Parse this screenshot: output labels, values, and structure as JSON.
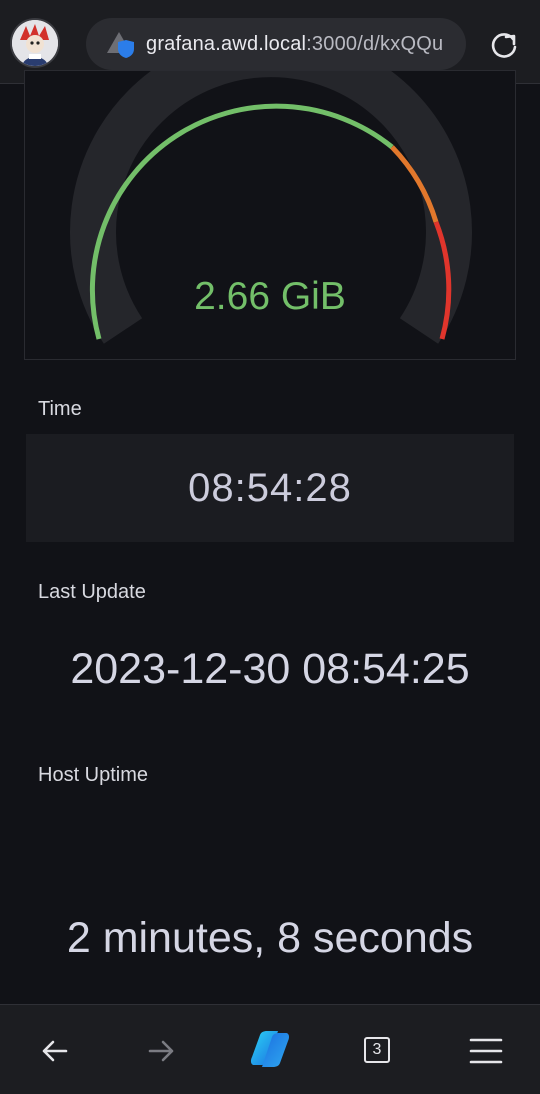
{
  "browser": {
    "url_host": "grafana.awd.local",
    "url_rest": ":3000/d/kxQQu",
    "tab_count": "3"
  },
  "gauge": {
    "value_text": "2.66 GiB",
    "fill_fraction": 0.07,
    "colors": {
      "value": "#73bf69",
      "track": "#25262b",
      "green": "#73bf69",
      "orange": "#e2782c",
      "red": "#e0352c"
    }
  },
  "time_panel": {
    "label": "Time",
    "value": "08:54:28"
  },
  "last_update_panel": {
    "label": "Last Update",
    "value": "2023-12-30 08:54:25"
  },
  "uptime_panel": {
    "label": "Host Uptime",
    "value": "2 minutes, 8 seconds"
  },
  "icons": {
    "avatar": "avatar-icon",
    "security": "not-secure-shield-icon",
    "reload": "reload-icon",
    "back": "back-arrow-icon",
    "forward": "forward-arrow-icon",
    "copilot": "copilot-icon",
    "tabs": "tabs-icon",
    "menu": "menu-icon"
  }
}
